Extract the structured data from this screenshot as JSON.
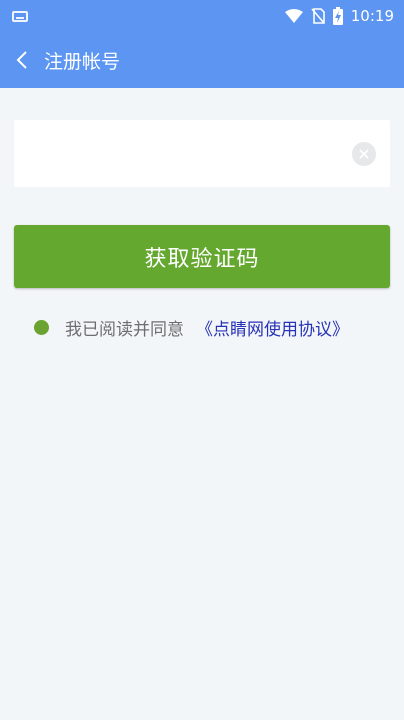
{
  "colors": {
    "header": "#5c95f2",
    "primary_button": "#65a830",
    "link": "#2732b8",
    "background": "#f3f6f8"
  },
  "status_bar": {
    "time": "10:19",
    "icons": [
      "keyboard-icon",
      "wifi-icon",
      "no-sim-icon",
      "battery-charging-icon"
    ]
  },
  "header": {
    "back_icon": "chevron-left-icon",
    "title": "注册帐号"
  },
  "form": {
    "phone": {
      "value": "",
      "placeholder": ""
    },
    "clear_icon": "clear-icon",
    "get_code_label": "获取验证码"
  },
  "agreement": {
    "text": "我已阅读并同意",
    "link_text": "《点睛网使用协议》"
  }
}
